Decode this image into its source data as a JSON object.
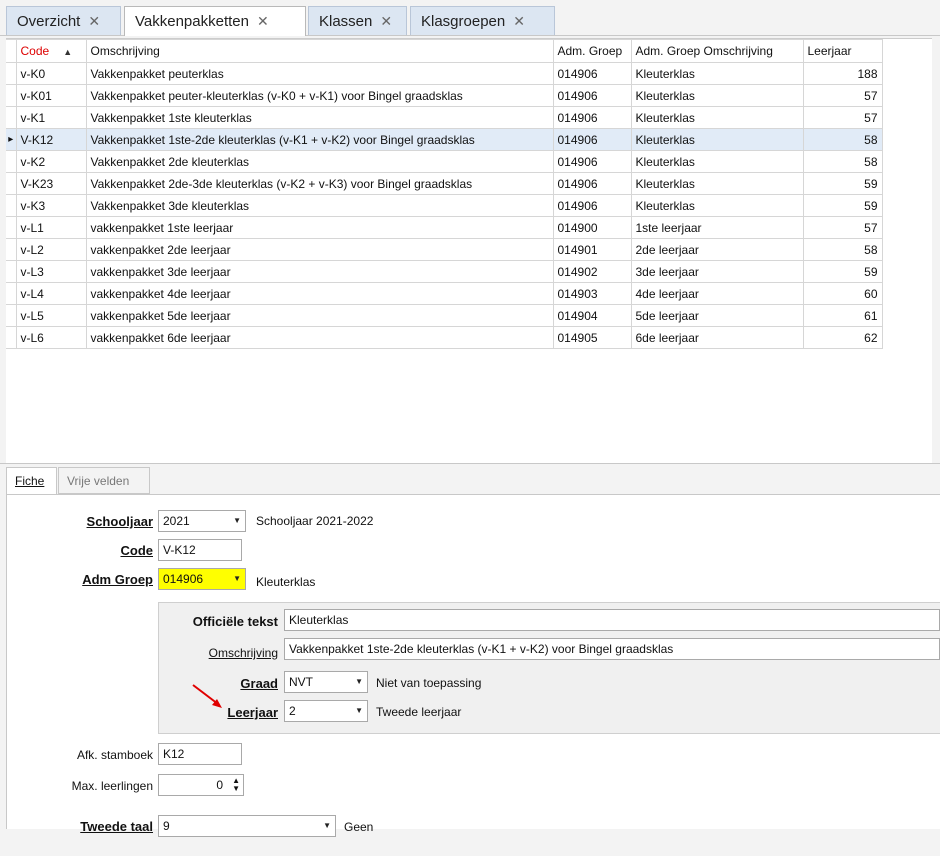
{
  "tabs": [
    {
      "label": "Overzicht",
      "active": false
    },
    {
      "label": "Vakkenpakketten",
      "active": true
    },
    {
      "label": "Klassen",
      "active": false
    },
    {
      "label": "Klasgroepen",
      "active": false
    }
  ],
  "close_glyph": "✕",
  "grid": {
    "columns": [
      "Code",
      "Omschrijving",
      "Adm. Groep",
      "Adm. Groep Omschrijving",
      "Leerjaar"
    ],
    "sort_column": "Code",
    "selected_row": 3,
    "rows": [
      [
        "v-K0",
        "Vakkenpakket peuterklas",
        "014906",
        "Kleuterklas",
        "188"
      ],
      [
        "v-K01",
        "Vakkenpakket peuter-kleuterklas (v-K0 + v-K1) voor Bingel graadsklas",
        "014906",
        "Kleuterklas",
        "57"
      ],
      [
        "v-K1",
        "Vakkenpakket 1ste kleuterklas",
        "014906",
        "Kleuterklas",
        "57"
      ],
      [
        "V-K12",
        "Vakkenpakket 1ste-2de kleuterklas  (v-K1 + v-K2) voor Bingel graadsklas",
        "014906",
        "Kleuterklas",
        "58"
      ],
      [
        "v-K2",
        "Vakkenpakket 2de kleuterklas",
        "014906",
        "Kleuterklas",
        "58"
      ],
      [
        "V-K23",
        "Vakkenpakket 2de-3de kleuterklas  (v-K2 + v-K3) voor Bingel graadsklas",
        "014906",
        "Kleuterklas",
        "59"
      ],
      [
        "v-K3",
        "Vakkenpakket 3de kleuterklas",
        "014906",
        "Kleuterklas",
        "59"
      ],
      [
        "v-L1",
        "vakkenpakket 1ste leerjaar",
        "014900",
        "1ste leerjaar",
        "57"
      ],
      [
        "v-L2",
        "vakkenpakket 2de leerjaar",
        "014901",
        "2de leerjaar",
        "58"
      ],
      [
        "v-L3",
        "vakkenpakket 3de leerjaar",
        "014902",
        "3de leerjaar",
        "59"
      ],
      [
        "v-L4",
        "vakkenpakket 4de leerjaar",
        "014903",
        "4de leerjaar",
        "60"
      ],
      [
        "v-L5",
        "vakkenpakket 5de leerjaar",
        "014904",
        "5de leerjaar",
        "61"
      ],
      [
        "v-L6",
        "vakkenpakket 6de leerjaar",
        "014905",
        "6de leerjaar",
        "62"
      ]
    ]
  },
  "detail_tabs": [
    {
      "label": "Fiche",
      "active": true
    },
    {
      "label": "Vrije velden",
      "active": false
    }
  ],
  "fiche": {
    "schooljaar": {
      "label": "Schooljaar",
      "value": "2021",
      "desc": "Schooljaar 2021-2022"
    },
    "code": {
      "label": "Code",
      "value": "V-K12"
    },
    "adm_groep": {
      "label": "Adm Groep",
      "value": "014906",
      "desc": "Kleuterklas",
      "highlight": "#ffff00"
    },
    "officiele_tekst": {
      "label": "Officiële tekst",
      "value": "Kleuterklas"
    },
    "omschrijving": {
      "label": "Omschrijving",
      "value": "Vakkenpakket 1ste-2de kleuterklas  (v-K1 + v-K2) voor Bingel graadsklas"
    },
    "graad": {
      "label": "Graad",
      "value": "NVT",
      "desc": "Niet van toepassing"
    },
    "leerjaar": {
      "label": "Leerjaar",
      "value": "2",
      "desc": "Tweede leerjaar"
    },
    "afk_stamboek": {
      "label": "Afk. stamboek",
      "value": "K12"
    },
    "max_leerlingen": {
      "label": "Max. leerlingen",
      "value": "0"
    },
    "tweede_taal": {
      "label": "Tweede taal",
      "value": "9",
      "desc": "Geen"
    }
  },
  "colors": {
    "annotation_arrow": "#e00000",
    "sort_header": "#dd0000",
    "selected_row": "#e1ebf7"
  }
}
